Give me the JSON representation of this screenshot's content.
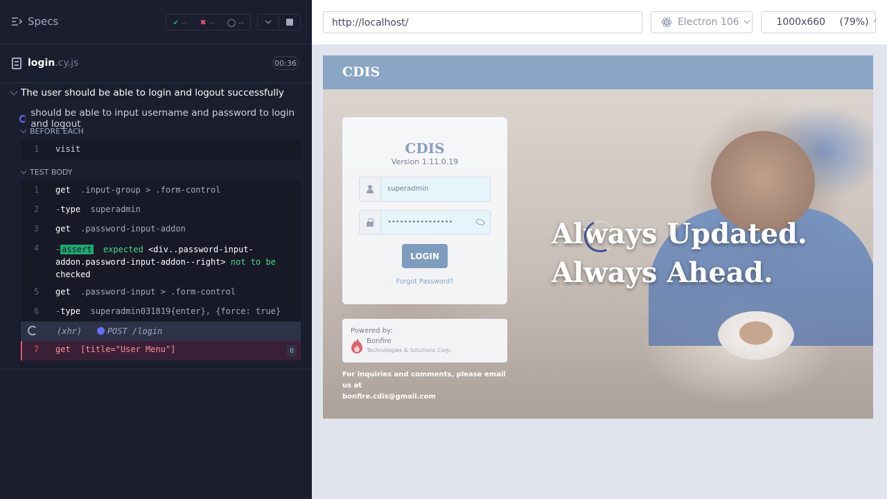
{
  "reporter": {
    "specs_label": "Specs",
    "stats": {
      "passed": "--",
      "failed": "--",
      "pending": "--"
    },
    "file": {
      "name": "login",
      "ext": ".cy.js",
      "duration": "00:36"
    },
    "suite_title": "The user should be able to login and logout successfully",
    "test_title": "should be able to input username and password to login and logout",
    "before_each": {
      "label": "BEFORE EACH",
      "commands": [
        {
          "num": "1",
          "name": "visit",
          "arg": ""
        }
      ]
    },
    "test_body": {
      "label": "TEST BODY",
      "commands": [
        {
          "num": "1",
          "name": "get",
          "arg": ".input-group > .form-control"
        },
        {
          "num": "2",
          "prefix": "-",
          "name": "type",
          "arg": "superadmin"
        },
        {
          "num": "3",
          "name": "get",
          "arg": ".password-input-addon"
        },
        {
          "num": "4",
          "prefix": "-",
          "tag": "assert",
          "expected": "expected",
          "subject": "<div..password-input-addon.password-input-addon--right>",
          "not_to_be": "not to be",
          "checked": "checked"
        },
        {
          "num": "5",
          "name": "get",
          "arg": ".password-input > .form-control"
        },
        {
          "num": "6",
          "prefix": "-",
          "name": "type",
          "arg": "superadmin031819{enter}, {force: true}"
        }
      ],
      "xhr": {
        "label": "(xhr)",
        "method_url": "POST /login"
      },
      "failing": {
        "num": "7",
        "name": "get",
        "arg": "[title=\"User Menu\"]",
        "count": "0"
      }
    },
    "colors": {
      "bg": "#1b1e2e",
      "pass": "#1fa971",
      "fail": "#e45770",
      "accent": "#6470f3"
    }
  },
  "runner": {
    "url": "http://localhost/",
    "browser": "Electron 106",
    "viewport": "1000x660",
    "scale": "(79%)",
    "icons": [
      "electron-icon",
      "ruler-icon",
      "chevron-down-icon"
    ]
  },
  "aut": {
    "brand": "CDIS",
    "login": {
      "title": "CDIS",
      "version": "Version 1.11.0.19",
      "username_value": "superadmin",
      "password_value": "••••••••••••••••",
      "login_button": "LOGIN",
      "forgot": "Forgot Password?"
    },
    "powered": {
      "label": "Powered by:",
      "company": "Bonfire",
      "sub": "Technologies & Solutions Corp."
    },
    "inquiry_line1": "For inquiries and comments, please email us at",
    "inquiry_line2": "bonfire.cdis@gmail.com",
    "tagline_1": "Always Updated.",
    "tagline_2": "Always Ahead."
  }
}
